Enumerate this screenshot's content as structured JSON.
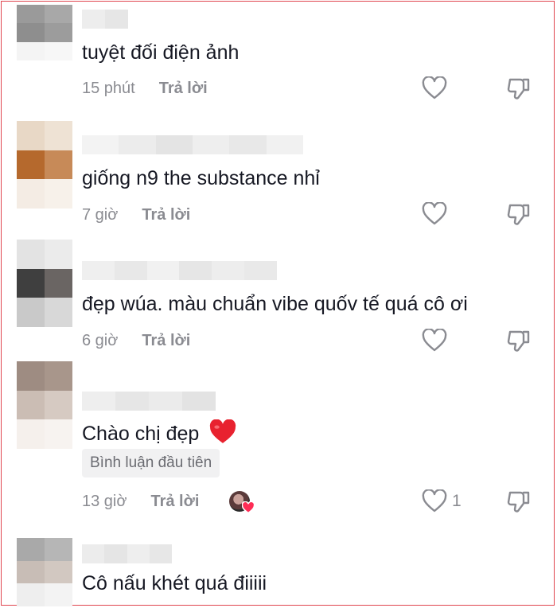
{
  "comments": [
    {
      "text": "tuyệt đối điện ảnh",
      "time": "15 phút",
      "reply_label": "Trả lời",
      "likes": "",
      "avatar_colors": [
        "#9a9a9a",
        "#a8a8a8",
        "#8e8e8e",
        "#9c9c9c",
        "#f4f4f4",
        "#f7f7f7"
      ],
      "name_colors": [
        "#ededed",
        "#e6e6e6"
      ]
    },
    {
      "text": "giống n9 the substance nhỉ",
      "time": "7 giờ",
      "reply_label": "Trả lời",
      "likes": "",
      "avatar_colors": [
        "#e8d8c6",
        "#eee2d4",
        "#b5692d",
        "#c78a58",
        "#f4ece4",
        "#f7f1ea"
      ],
      "name_colors": [
        "#f3f3f3",
        "#ececec",
        "#e4e4e4",
        "#eeeeee",
        "#e8e8e8",
        "#f1f1f1"
      ]
    },
    {
      "text": "đẹp wúa. màu chuẩn vibe quốv tế quá cô ơi",
      "time": "6 giờ",
      "reply_label": "Trả lời",
      "likes": "",
      "avatar_colors": [
        "#e3e3e3",
        "#ebebeb",
        "#3f3f3f",
        "#6a6563",
        "#c9c9c9",
        "#d8d8d8"
      ],
      "name_colors": [
        "#efefef",
        "#e8e8e8",
        "#f1f1f1",
        "#e6e6e6",
        "#ededed",
        "#e9e9e9"
      ]
    },
    {
      "text": "Chào chị đẹp",
      "time": "13 giờ",
      "reply_label": "Trả lời",
      "likes": "1",
      "badge": "Bình luận đầu tiên",
      "avatar_colors": [
        "#9e8c82",
        "#a8968b",
        "#cbbdb4",
        "#d6cac2",
        "#f5f0ec",
        "#f7f3f0"
      ],
      "name_colors": [
        "#eeeeee",
        "#e6e6e6",
        "#ebebeb",
        "#e3e3e3"
      ]
    },
    {
      "text": "Cô nấu khét quá điiiii",
      "time": "",
      "reply_label": "",
      "likes": "",
      "avatar_colors": [
        "#a9a9a9",
        "#b6b6b6",
        "#c8bdb6",
        "#d2c8c1",
        "#eeeeee",
        "#f3f3f3"
      ],
      "name_colors": [
        "#ececec",
        "#e5e5e5",
        "#eeeeee",
        "#e7e7e7"
      ]
    }
  ],
  "icons": {
    "like": "heart-outline-icon",
    "dislike": "thumbs-down-outline-icon",
    "emoji": "red-heart-emoji",
    "author_liked": "author-liked-avatar"
  },
  "colors": {
    "text": "#161823",
    "meta": "#8a8b91",
    "border": "#e0454f",
    "heart_emoji": "#e8222f",
    "badge_bg": "#f1f1f2"
  }
}
